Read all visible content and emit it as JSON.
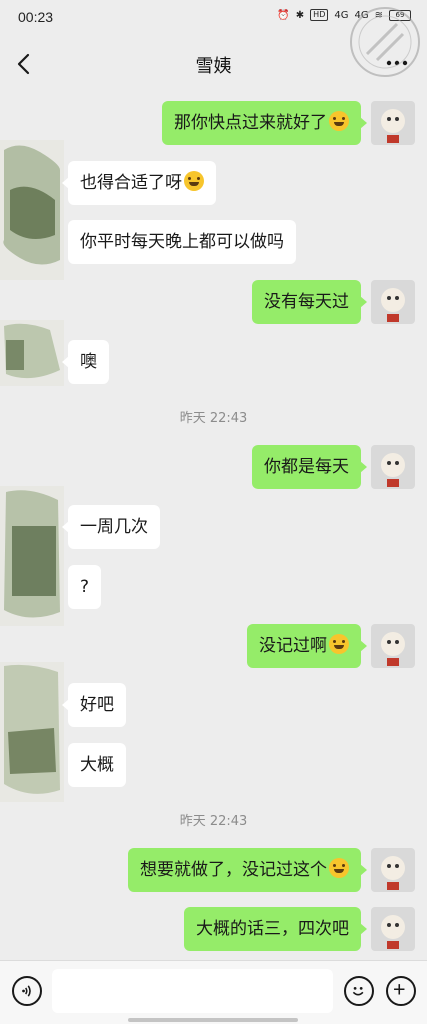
{
  "status_bar": {
    "time": "00:23",
    "hd": "HD",
    "net1": "4G",
    "net2": "4G",
    "battery": "69"
  },
  "header": {
    "title": "雪姨"
  },
  "messages": [
    {
      "side": "self",
      "text": "那你快点过来就好了",
      "emoji": "grin-emoji"
    },
    {
      "side": "other",
      "text": "也得合适了呀",
      "emoji": "laugh-cry-emoji"
    },
    {
      "side": "other",
      "text": "你平时每天晚上都可以做吗"
    },
    {
      "side": "self",
      "text": "没有每天过"
    },
    {
      "side": "other",
      "text": "噢"
    },
    {
      "side": "self",
      "text": "你都是每天"
    },
    {
      "side": "other",
      "text": "一周几次"
    },
    {
      "side": "other",
      "text": "?"
    },
    {
      "side": "self",
      "text": "没记过啊",
      "emoji": "laugh-cry-emoji"
    },
    {
      "side": "other",
      "text": "好吧"
    },
    {
      "side": "other",
      "text": "大概"
    },
    {
      "side": "self",
      "text": "想要就做了，没记过这个",
      "emoji": "laugh-cry-emoji"
    },
    {
      "side": "self",
      "text": "大概的话三，四次吧"
    }
  ],
  "timestamps": [
    "昨天 22:43",
    "昨天 22:43"
  ],
  "input": {
    "value": ""
  },
  "colors": {
    "background": "#ededed",
    "self_bubble": "#95ec69",
    "other_bubble": "#ffffff"
  }
}
